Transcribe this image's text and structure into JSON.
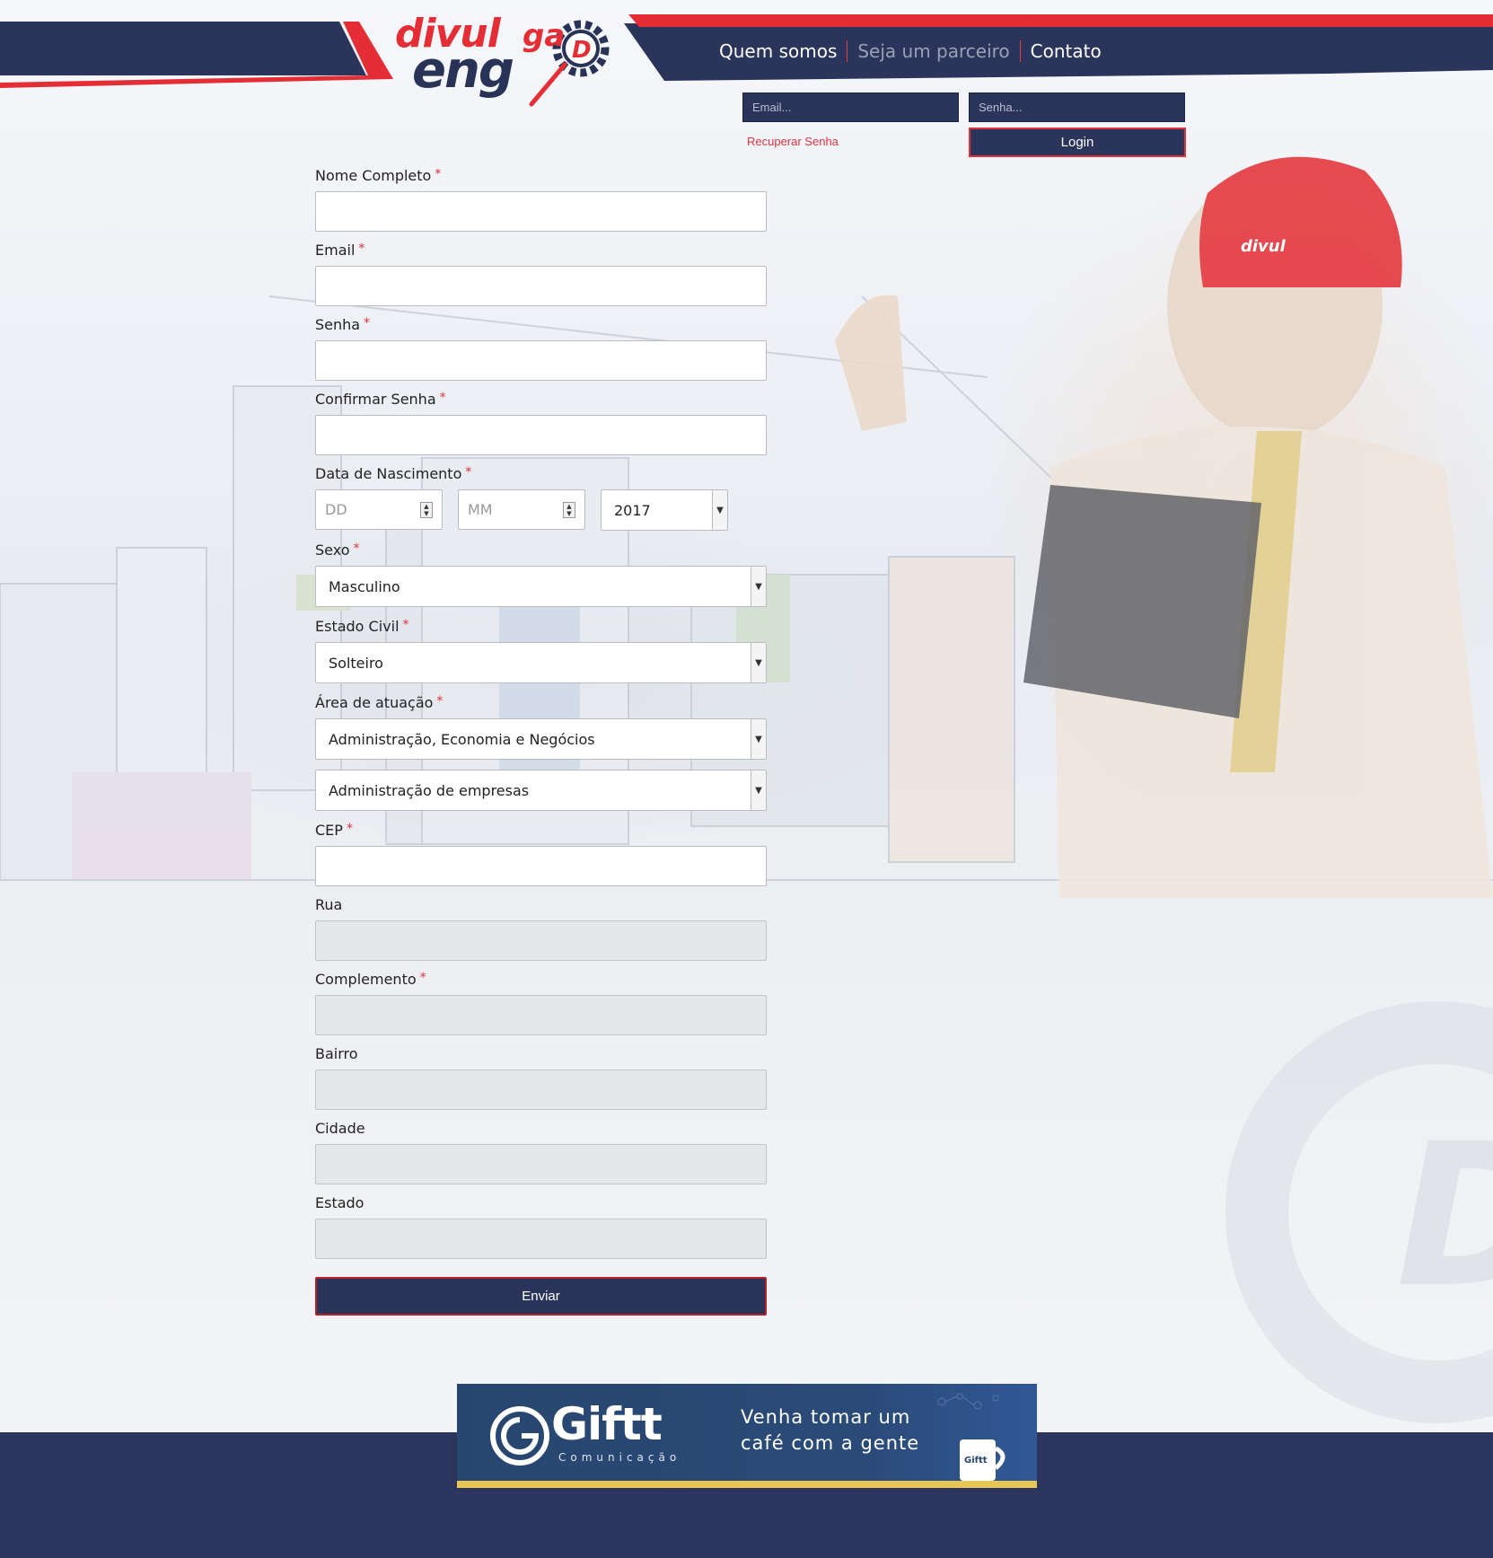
{
  "colors": {
    "navy": "#2b355c",
    "red": "#e52d35",
    "footer": "#2b355d",
    "banner_accent": "#e7c653"
  },
  "logo": {
    "line1": "divul",
    "accent": "ga",
    "line2": "eng",
    "badge": "D"
  },
  "nav": {
    "items": [
      {
        "label": "Quem somos"
      },
      {
        "label": "Seja um parceiro"
      },
      {
        "label": "Contato"
      }
    ]
  },
  "login": {
    "email_placeholder": "Email...",
    "password_placeholder": "Senha...",
    "recover_label": "Recuperar Senha",
    "login_label": "Login"
  },
  "form": {
    "required_mark": "*",
    "nome_label": "Nome Completo",
    "email_label": "Email",
    "senha_label": "Senha",
    "confirmar_label": "Confirmar Senha",
    "nascimento_label": "Data de Nascimento",
    "dia_placeholder": "DD",
    "mes_placeholder": "MM",
    "ano_value": "2017",
    "sexo_label": "Sexo",
    "sexo_value": "Masculino",
    "estado_civil_label": "Estado Civil",
    "estado_civil_value": "Solteiro",
    "area_label": "Área de atuação",
    "area_value": "Administração, Economia e Negócios",
    "subarea_value": "Administração de empresas",
    "cep_label": "CEP",
    "rua_label": "Rua",
    "complemento_label": "Complemento",
    "bairro_label": "Bairro",
    "cidade_label": "Cidade",
    "estado_label": "Estado",
    "submit_label": "Enviar"
  },
  "banner": {
    "brand": "Giftt",
    "brand_sub": "Comunicação",
    "tagline_1": "Venha tomar um",
    "tagline_2": "café com a gente",
    "mug_text": "Giftt"
  }
}
